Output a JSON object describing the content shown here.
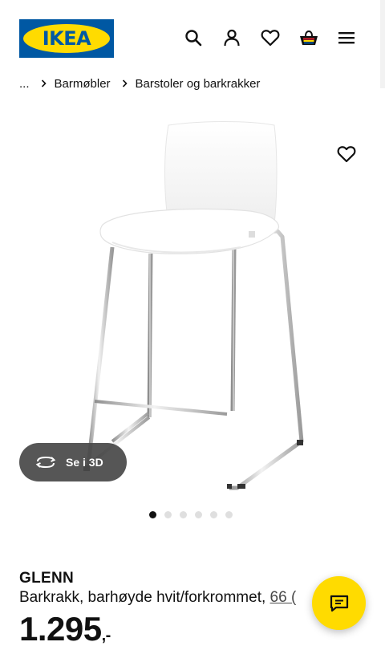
{
  "header": {
    "logo_text": "IKEA",
    "icons": [
      "search-icon",
      "user-icon",
      "heart-icon",
      "cart-icon",
      "menu-icon"
    ],
    "brand_blue": "#0058a3",
    "brand_yellow": "#ffdb00"
  },
  "breadcrumb": {
    "ellipsis": "...",
    "items": [
      "Barmøbler",
      "Barstoler og barkrakker"
    ]
  },
  "gallery": {
    "view_3d_label": "Se i 3D",
    "dot_count": 6,
    "active_dot": 1
  },
  "product": {
    "name": "GLENN",
    "description": "Barkrakk, barhøyde hvit/forkrommet, ",
    "reviews": "66 (",
    "price": "1.295",
    "price_suffix": ",-"
  }
}
